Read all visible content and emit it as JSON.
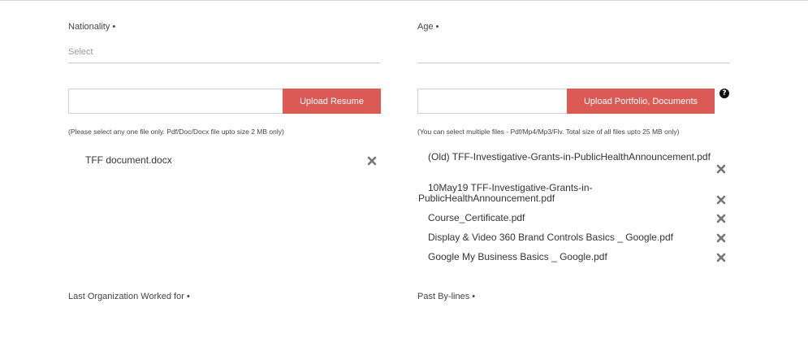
{
  "form": {
    "nationality": {
      "label": "Nationality",
      "placeholder": "Select"
    },
    "age": {
      "label": "Age"
    },
    "required_mark": "•",
    "resume": {
      "button": "Upload Resume",
      "note": "(Please select any one file only. Pdf/Doc/Docx file upto size 2 MB only)",
      "files": [
        "TFF document.docx"
      ]
    },
    "portfolio": {
      "button": "Upload Portfolio, Documents",
      "help": "?",
      "note": "(You can select multiple files - Pdf/Mp4/Mp3/Flv. Total size of all files upto 25 MB only)",
      "files": [
        "(Old) TFF-Investigative-Grants-in-PublicHealthAnnouncement.pdf",
        "10May19 TFF-Investigative-Grants-in-PublicHealthAnnouncement.pdf",
        "Course_Certificate.pdf",
        "Display & Video 360 Brand Controls Basics _ Google.pdf",
        "Google My Business Basics _ Google.pdf"
      ],
      "file2_line1": "10May19 TFF-Investigative-Grants-in-",
      "file2_line2": "PublicHealthAnnouncement.pdf"
    },
    "last_org": {
      "label": "Last Organization Worked for"
    },
    "past_bylines": {
      "label": "Past By-lines"
    }
  },
  "icons": {
    "remove": "close-x-icon",
    "help": "question-circle-icon"
  },
  "colors": {
    "accent": "#dc5a55",
    "remove_icon": "#777777"
  }
}
